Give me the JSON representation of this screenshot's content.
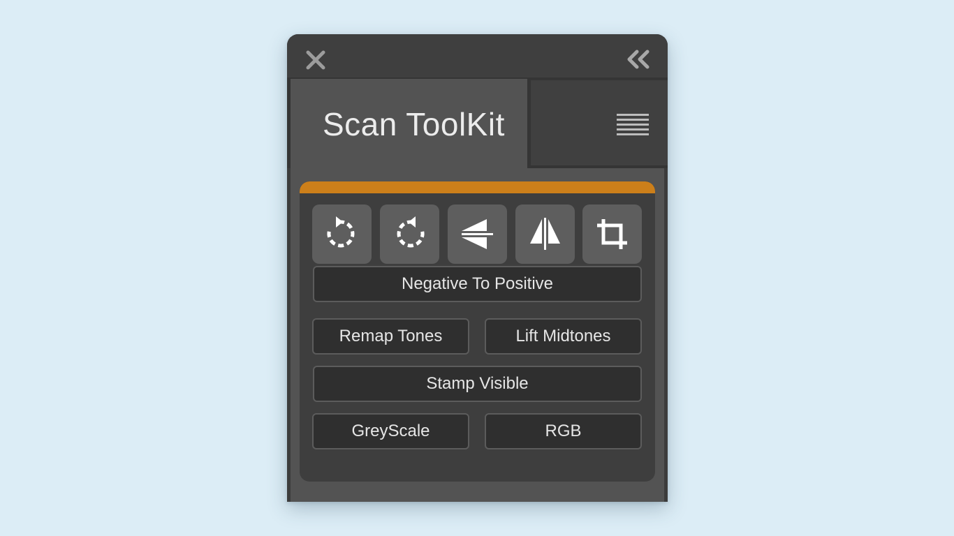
{
  "panel": {
    "title_bar": {
      "close_icon": "close-x-icon",
      "collapse_icon": "double-chevron-left-icon"
    },
    "tab": {
      "title": "Scan ToolKit",
      "menu_icon": "hamburger-menu-icon"
    },
    "card": {
      "accent_color": "#cc7f1a",
      "tools": [
        {
          "icon": "rotate-counterclockwise-icon"
        },
        {
          "icon": "rotate-clockwise-icon"
        },
        {
          "icon": "flip-vertical-icon"
        },
        {
          "icon": "flip-horizontal-icon"
        },
        {
          "icon": "crop-icon"
        }
      ],
      "buttons": {
        "negative_to_positive": "Negative To Positive",
        "remap_tones": "Remap Tones",
        "lift_midtones": "Lift Midtones",
        "stamp_visible": "Stamp Visible",
        "greyscale": "GreyScale",
        "rgb": "RGB"
      }
    }
  }
}
